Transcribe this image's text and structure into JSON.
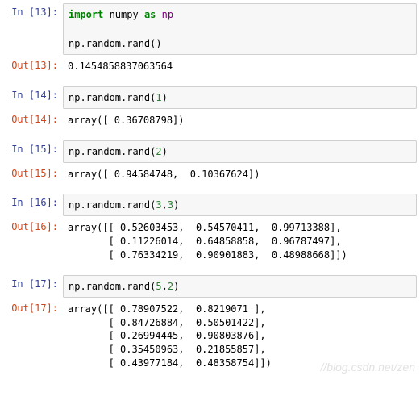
{
  "cells": {
    "c13": {
      "in_prompt": "In [13]:",
      "out_prompt": "Out[13]:",
      "code_line1_prefix": "import",
      "code_line1_mid": " numpy ",
      "code_line1_as": "as",
      "code_line1_suffix": " np",
      "code_line2": "np.random.rand()",
      "output": "0.1454858837063564"
    },
    "c14": {
      "in_prompt": "In [14]:",
      "out_prompt": "Out[14]:",
      "code_prefix": "np.random.rand(",
      "code_arg": "1",
      "code_suffix": ")",
      "output": "array([ 0.36708798])"
    },
    "c15": {
      "in_prompt": "In [15]:",
      "out_prompt": "Out[15]:",
      "code_prefix": "np.random.rand(",
      "code_arg": "2",
      "code_suffix": ")",
      "output": "array([ 0.94584748,  0.10367624])"
    },
    "c16": {
      "in_prompt": "In [16]:",
      "out_prompt": "Out[16]:",
      "code_prefix": "np.random.rand(",
      "code_arg1": "3",
      "code_comma": ",",
      "code_arg2": "3",
      "code_suffix": ")",
      "output": "array([[ 0.52603453,  0.54570411,  0.99713388],\n       [ 0.11226014,  0.64858858,  0.96787497],\n       [ 0.76334219,  0.90901883,  0.48988668]])"
    },
    "c17": {
      "in_prompt": "In [17]:",
      "out_prompt": "Out[17]:",
      "code_prefix": "np.random.rand(",
      "code_arg1": "5",
      "code_comma": ",",
      "code_arg2": "2",
      "code_suffix": ")",
      "output": "array([[ 0.78907522,  0.8219071 ],\n       [ 0.84726884,  0.50501422],\n       [ 0.26994445,  0.90803876],\n       [ 0.35450963,  0.21855857],\n       [ 0.43977184,  0.48358754]])"
    }
  },
  "watermark": "//blog.csdn.net/zen"
}
